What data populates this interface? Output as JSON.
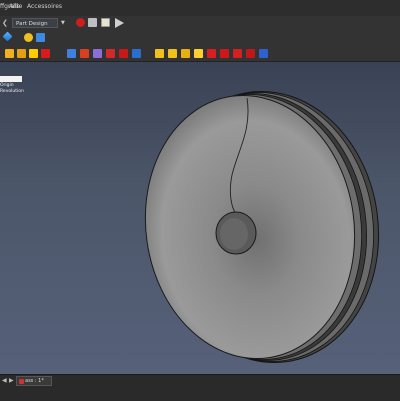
{
  "menu": {
    "items": [
      {
        "label": "Aide",
        "prefix": "ffgrafe"
      },
      {
        "label": "Accessoires"
      }
    ]
  },
  "toolbar": {
    "workbench_selected": "Part Design",
    "run_macro_icon": "play-icon"
  },
  "tree": {
    "header": "",
    "items": [
      "Origin",
      "Revolution"
    ]
  },
  "tabs": [
    {
      "label": "ass : 1*"
    }
  ],
  "colors": {
    "background_top": "#3a4255",
    "background_bottom": "#56617a",
    "model_fill": "#8a8a8a",
    "model_edge": "#1a1a1a",
    "record_red": "#cc1e1e"
  }
}
